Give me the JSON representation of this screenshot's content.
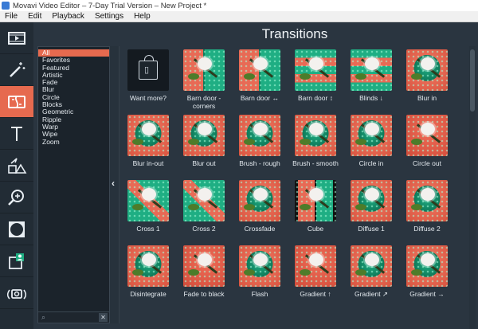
{
  "window": {
    "title": "Movavi Video Editor – 7-Day Trial Version – New Project *"
  },
  "menu": {
    "items": [
      "File",
      "Edit",
      "Playback",
      "Settings",
      "Help"
    ]
  },
  "tools": [
    {
      "icon": "film-icon"
    },
    {
      "icon": "magic-wand-icon"
    },
    {
      "icon": "transitions-icon",
      "active": true
    },
    {
      "icon": "text-icon"
    },
    {
      "icon": "shapes-icon"
    },
    {
      "icon": "zoom-icon"
    },
    {
      "icon": "vignette-icon"
    },
    {
      "icon": "user-export-icon"
    },
    {
      "icon": "camera-icon"
    }
  ],
  "panel": {
    "title": "Transitions",
    "categories": [
      "All",
      "Favorites",
      "Featured",
      "Artistic",
      "Fade",
      "Blur",
      "Circle",
      "Blocks",
      "Geometric",
      "Ripple",
      "Warp",
      "Wipe",
      "Zoom"
    ],
    "selected_category": "All",
    "collapse_glyph": "‹"
  },
  "transitions": [
    {
      "label": "Want more?",
      "fx": "more"
    },
    {
      "label": "Barn door - corners",
      "fx": "split"
    },
    {
      "label": "Barn door ↔",
      "fx": "split"
    },
    {
      "label": "Barn door ↕",
      "fx": "bars"
    },
    {
      "label": "Blinds ↓",
      "fx": "bars"
    },
    {
      "label": "Blur in",
      "fx": "photo"
    },
    {
      "label": "Blur in-out",
      "fx": "photo"
    },
    {
      "label": "Blur out",
      "fx": "photo"
    },
    {
      "label": "Brush - rough",
      "fx": "photo"
    },
    {
      "label": "Brush - smooth",
      "fx": "photo"
    },
    {
      "label": "Circle in",
      "fx": "photo"
    },
    {
      "label": "Circle out",
      "fx": "plain"
    },
    {
      "label": "Cross 1",
      "fx": "x"
    },
    {
      "label": "Cross 2",
      "fx": "x"
    },
    {
      "label": "Crossfade",
      "fx": "photo"
    },
    {
      "label": "Cube",
      "fx": "cube"
    },
    {
      "label": "Diffuse 1",
      "fx": "photo"
    },
    {
      "label": "Diffuse 2",
      "fx": "photo"
    },
    {
      "label": "Disintegrate",
      "fx": "photo"
    },
    {
      "label": "Fade to black",
      "fx": "plain"
    },
    {
      "label": "Flash",
      "fx": "photo"
    },
    {
      "label": "Gradient ↑",
      "fx": "plain"
    },
    {
      "label": "Gradient ↗",
      "fx": "photo"
    },
    {
      "label": "Gradient →",
      "fx": "photo"
    }
  ]
}
